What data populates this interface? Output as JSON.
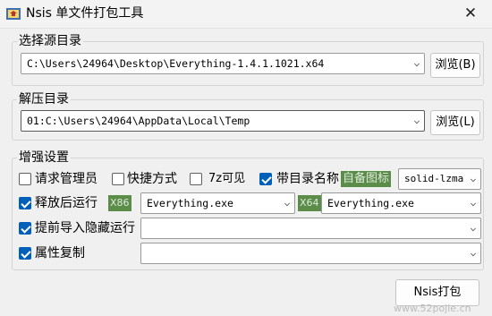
{
  "window": {
    "title": "Nsis 单文件打包工具",
    "close_glyph": "✕",
    "icon": "installer-box-icon"
  },
  "source": {
    "legend": "选择源目录",
    "path": "C:\\Users\\24964\\Desktop\\Everything-1.4.1.1021.x64",
    "browse_label": "浏览(B)"
  },
  "extract": {
    "legend": "解压目录",
    "path": "01:C:\\Users\\24964\\AppData\\Local\\Temp",
    "browse_label": "浏览(L)"
  },
  "enhanced": {
    "legend": "增强设置",
    "request_admin": {
      "label": "请求管理员",
      "checked": false
    },
    "shortcut": {
      "label": "快捷方式",
      "checked": false
    },
    "visible_7z": {
      "label": "7z可见",
      "checked": false
    },
    "with_dir_name": {
      "label": "带目录名称",
      "checked": true
    },
    "custom_icon_label": "自备图标",
    "compression": "solid-lzma",
    "run_after_extract": {
      "label": "释放后运行",
      "checked": true
    },
    "x86_tag": "X86",
    "x86_exe": "Everything.exe",
    "x64_tag": "X64",
    "x64_exe": "Everything.exe",
    "pre_import_hidden": {
      "label": "提前导入隐藏运行",
      "checked": true
    },
    "pre_import_value": "",
    "copy_attributes": {
      "label": "属性复制",
      "checked": true
    },
    "copy_attributes_value": ""
  },
  "pack_button_label": "Nsis打包",
  "watermark": "www.52pojie.cn"
}
